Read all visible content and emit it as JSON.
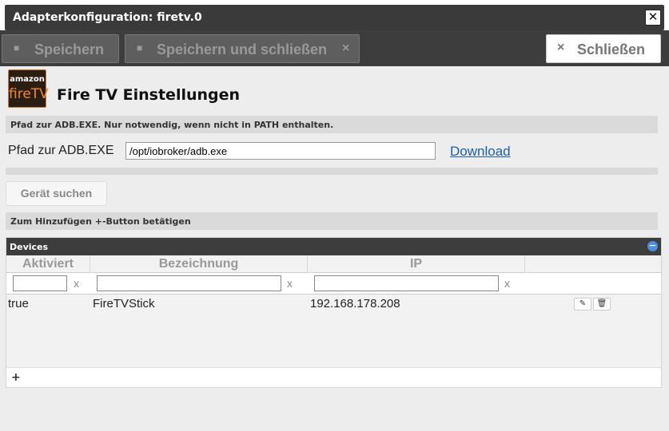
{
  "window": {
    "title": "Adapterkonfiguration: firetv.0",
    "close_glyph": "✕"
  },
  "toolbar": {
    "save_label": "Speichern",
    "save_close_label": "Speichern und schließen",
    "save_close_x": "×",
    "close_label": "Schließen",
    "close_x": "×",
    "save_icon": "floppy-icon"
  },
  "logo": {
    "line1": "amazon",
    "line2": "fireTV"
  },
  "page": {
    "title": "Fire TV Einstellungen"
  },
  "adb_section": {
    "info": "Pfad zur ADB.EXE. Nur notwendig, wenn nicht in PATH enthalten.",
    "label": "Pfad zur ADB.EXE",
    "value": "/opt/iobroker/adb.exe",
    "download_link": "Download"
  },
  "search": {
    "button_label": "Gerät suchen"
  },
  "hint": "Zum Hinzufügen +-Button betätigen",
  "devices": {
    "header": "Devices",
    "collapse_glyph": "−",
    "columns": [
      "Aktiviert",
      "Bezeichnung",
      "IP",
      ""
    ],
    "filter_clear": "x",
    "rows": [
      {
        "aktiviert": "true",
        "bezeichnung": "FireTVStick",
        "ip": "192.168.178.208"
      }
    ],
    "edit_glyph": "✎",
    "delete_glyph": "🗑",
    "add_glyph": "+"
  }
}
